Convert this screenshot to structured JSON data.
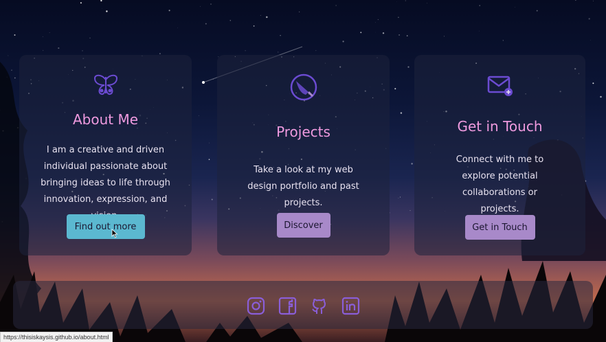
{
  "colors": {
    "heading": "#ef9adf",
    "accent_button": "#5bb8d0",
    "purple_button": "#a889c9",
    "icon": "#6b4bd1"
  },
  "cards": [
    {
      "icon": "butterfly-icon",
      "title": "About Me",
      "text": "I am a creative and driven individual passionate about bringing ideas to life through innovation, expression, and vision.",
      "button": "Find out more"
    },
    {
      "icon": "paintbrush-icon",
      "title": "Projects",
      "text": "Take a look at my web design portfolio and past projects.",
      "button": "Discover"
    },
    {
      "icon": "mail-icon",
      "title": "Get in Touch",
      "text": "Connect with me to explore potential collaborations or projects.",
      "button": "Get in Touch"
    }
  ],
  "footer": {
    "social": [
      "instagram-icon",
      "facebook-icon",
      "github-icon",
      "linkedin-icon"
    ]
  },
  "status_url": "https://thisiskaysis.github.io/about.html"
}
